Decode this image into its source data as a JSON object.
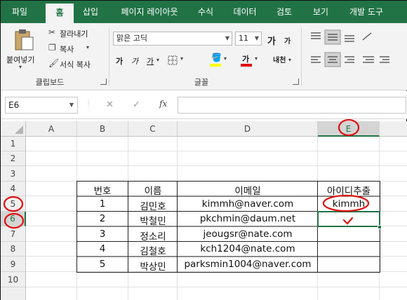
{
  "ribbon_tabs": [
    "파일",
    "홈",
    "삽입",
    "페이지 레이아웃",
    "수식",
    "데이터",
    "검토",
    "보기",
    "개발 도구"
  ],
  "active_tab": "홈",
  "clipboard": {
    "paste": "붙여넣기",
    "cut": "잘라내기",
    "copy": "복사",
    "format_painter": "서식 복사",
    "group_label": "클립보드"
  },
  "font": {
    "font_name": "맑은 고딕",
    "font_size": "11",
    "grow": "가",
    "shrink": "가",
    "bold": "가",
    "italic": "가",
    "underline": "가",
    "font_color": "가",
    "phonetic": "내천",
    "group_label": "글꼴"
  },
  "formula_bar": {
    "name_box": "E6",
    "fx": "fx",
    "formula": ""
  },
  "columns": [
    "A",
    "B",
    "C",
    "D",
    "E"
  ],
  "rows": [
    "1",
    "2",
    "3",
    "4",
    "5",
    "6",
    "7",
    "8",
    "9",
    "10"
  ],
  "table": {
    "headers": [
      "번호",
      "이름",
      "이메일",
      "아이디추출"
    ],
    "rows": [
      [
        "1",
        "김민호",
        "kimmh@naver.com",
        "kimmh"
      ],
      [
        "2",
        "박철민",
        "pkchmin@daum.net",
        ""
      ],
      [
        "3",
        "정소리",
        "jeougsr@nate.com",
        ""
      ],
      [
        "4",
        "김철호",
        "kch1204@nate.com",
        ""
      ],
      [
        "5",
        "박상민",
        "parksmin1004@naver.com",
        ""
      ]
    ]
  },
  "selected_cell": "E6",
  "colors": {
    "ribbon_green": "#217346",
    "annotation_red": "#e01010"
  }
}
